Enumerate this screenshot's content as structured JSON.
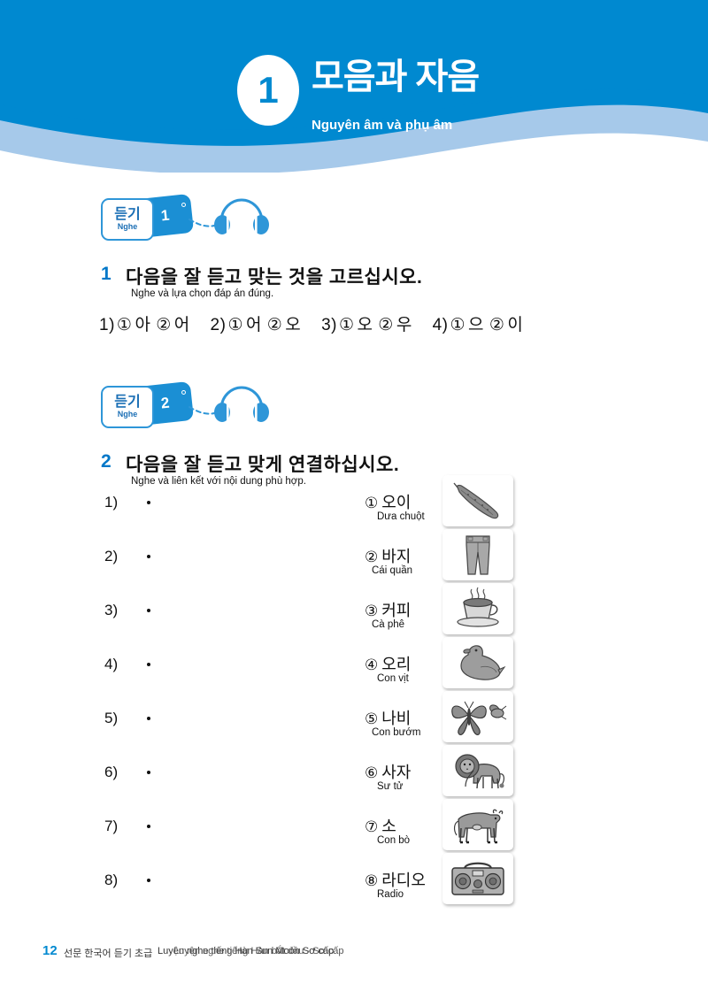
{
  "header": {
    "chapter_number": "1",
    "title_ko": "모음과 자음",
    "title_vi": "Nguyên âm và phụ âm",
    "color_primary": "#0089d0",
    "color_wave_light": "#a6c9ea"
  },
  "badges": [
    {
      "ko": "듣기",
      "vi": "Nghe",
      "track": "1"
    },
    {
      "ko": "듣기",
      "vi": "Nghe",
      "track": "2"
    }
  ],
  "exercise1": {
    "number": "1",
    "instruction_ko": "다음을 잘 듣고 맞는 것을 고르십시오.",
    "instruction_vi": "Nghe và lựa chọn đáp án đúng.",
    "items": [
      {
        "label": "1)",
        "option1_mark": "①",
        "option1": "아",
        "option2_mark": "②",
        "option2": "어"
      },
      {
        "label": "2)",
        "option1_mark": "①",
        "option1": "어",
        "option2_mark": "②",
        "option2": "오"
      },
      {
        "label": "3)",
        "option1_mark": "①",
        "option1": "오",
        "option2_mark": "②",
        "option2": "우"
      },
      {
        "label": "4)",
        "option1_mark": "①",
        "option1": "으",
        "option2_mark": "②",
        "option2": "이"
      }
    ]
  },
  "exercise2": {
    "number": "2",
    "instruction_ko": "다음을 잘 듣고 맞게 연결하십시오.",
    "instruction_vi": "Nghe và liên kết với nội dung phù hợp.",
    "left_items": [
      {
        "label": "1)"
      },
      {
        "label": "2)"
      },
      {
        "label": "3)"
      },
      {
        "label": "4)"
      },
      {
        "label": "5)"
      },
      {
        "label": "6)"
      },
      {
        "label": "7)"
      },
      {
        "label": "8)"
      }
    ],
    "right_items": [
      {
        "mark": "①",
        "ko": "오이",
        "vi": "Dưa chuột",
        "picture": "cucumber-picture"
      },
      {
        "mark": "②",
        "ko": "바지",
        "vi": "Cái quần",
        "picture": "trousers-picture"
      },
      {
        "mark": "③",
        "ko": "커피",
        "vi": "Cà phê",
        "picture": "coffee-cup-picture"
      },
      {
        "mark": "④",
        "ko": "오리",
        "vi": "Con vịt",
        "picture": "duck-picture"
      },
      {
        "mark": "⑤",
        "ko": "나비",
        "vi": "Con bướm",
        "picture": "butterfly-picture"
      },
      {
        "mark": "⑥",
        "ko": "사자",
        "vi": "Sư tử",
        "picture": "lion-picture"
      },
      {
        "mark": "⑦",
        "ko": "소",
        "vi": "Con bò",
        "picture": "cow-picture"
      },
      {
        "mark": "⑧",
        "ko": "라디오",
        "vi": "Radio",
        "picture": "radio-picture"
      }
    ]
  },
  "footer": {
    "page_number": "12",
    "book_ko": "선문 한국어 듣기 초급",
    "book_vi_layer1": "Luyện nghe tiếng Hàn Sun Moon Sơ cấp",
    "book_vi_layer2": "Luyện nghe tiếng Hàn bắt đầu - Sơ cấp"
  }
}
